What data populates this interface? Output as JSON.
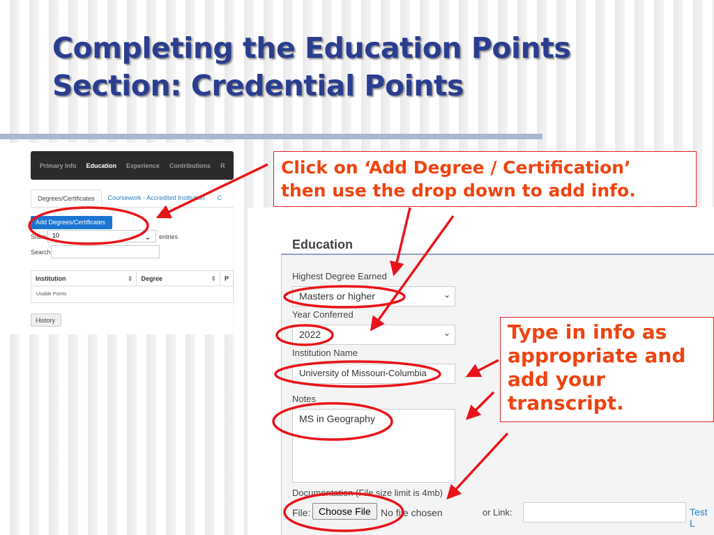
{
  "slide": {
    "title_line1": "Completing the Education Points",
    "title_line2": "Section: Credential Points",
    "callout1_line1": "Click on ‘Add Degree / Certification’",
    "callout1_line2": "then use the drop down to add info.",
    "callout2_lines": [
      "Type in info as",
      "appropriate and",
      "add your",
      "transcript."
    ],
    "accent_color": "#ee4411",
    "annotation_color": "#e8141a"
  },
  "portal": {
    "nav": [
      "Primary Info",
      "Education",
      "Experience",
      "Contributions",
      "R"
    ],
    "tabs": [
      "Degrees/Certificates",
      "Coursework - Accredited Institution",
      "C"
    ],
    "add_button": "Add Degrees/Certificates",
    "show_label": "Show",
    "show_value": "10",
    "entries_label": "entries",
    "search_label": "Search:",
    "columns": [
      "Institution",
      "Degree",
      "P"
    ],
    "row": "Usable Points",
    "history_button": "History"
  },
  "form": {
    "heading": "Education",
    "degree_label": "Highest Degree Earned",
    "degree_value": "Masters or higher",
    "year_label": "Year Conferred",
    "year_value": "2022",
    "institution_label": "Institution Name",
    "institution_value": "University of Missouri-Columbia",
    "notes_label": "Notes",
    "notes_value": "MS in Geography",
    "doc_label": "Documentation (File size limit is 4mb)",
    "file_label": "File:",
    "choose_file": "Choose File",
    "no_file": "No file chosen",
    "link_label": "or Link:",
    "link_value": "",
    "test_link": "Test L"
  }
}
